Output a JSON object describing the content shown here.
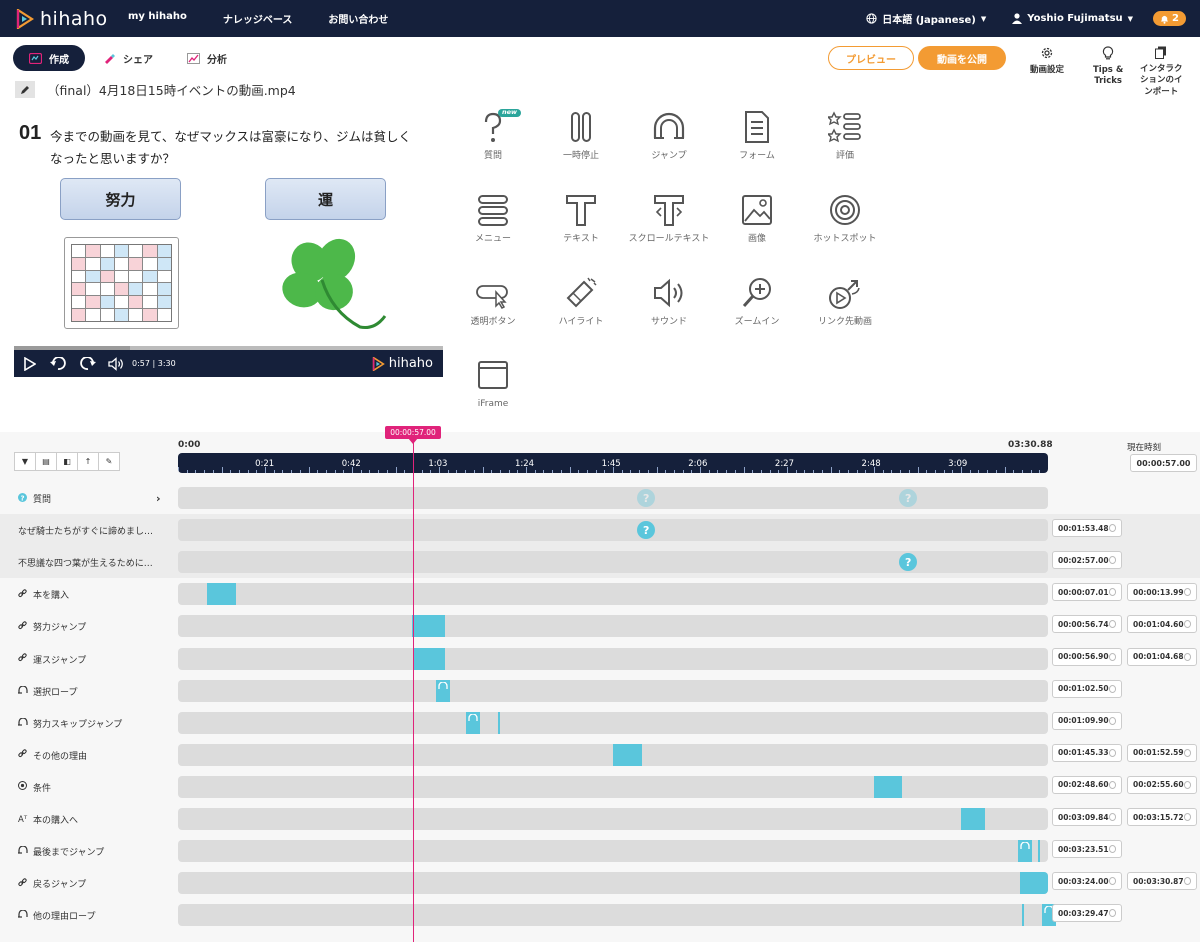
{
  "nav": {
    "brand": "hihaho",
    "links": [
      "my hihaho",
      "ナレッジベース",
      "お問い合わせ"
    ],
    "language": "日本語 (Japanese)",
    "user": "Yoshio Fujimatsu",
    "notifications": "2"
  },
  "tabs": [
    {
      "label": "作成",
      "active": true
    },
    {
      "label": "シェア",
      "active": false
    },
    {
      "label": "分析",
      "active": false
    }
  ],
  "file_title": "（final）4月18日15時イベントの動画.mp4",
  "actions": {
    "preview": "プレビュー",
    "publish": "動画を公開",
    "settings": "動画設定",
    "tips_line1": "Tips &",
    "tips_line2": "Tricks",
    "import_line1": "インタラク",
    "import_line2": "ションのイ",
    "import_line3": "ンポート"
  },
  "video": {
    "question_number": "01",
    "question_line1": "今までの動画を見て、なぜマックスは富豪になり、ジムは貧しく",
    "question_line2": "なったと思いますか？",
    "answer1": "努力",
    "answer2": "運",
    "time": "0:57 | 3:30",
    "brand": "hihaho",
    "progress": 0.27
  },
  "widgets": [
    {
      "label": "質問",
      "icon": "question-icon",
      "badge": "new"
    },
    {
      "label": "一時停止",
      "icon": "pause-icon"
    },
    {
      "label": "ジャンプ",
      "icon": "jump-icon"
    },
    {
      "label": "フォーム",
      "icon": "form-icon"
    },
    {
      "label": "評価",
      "icon": "rating-icon"
    },
    {
      "label": "メニュー",
      "icon": "menu-icon"
    },
    {
      "label": "テキスト",
      "icon": "text-icon"
    },
    {
      "label": "スクロールテキスト",
      "icon": "scroll-text-icon"
    },
    {
      "label": "画像",
      "icon": "image-icon"
    },
    {
      "label": "ホットスポット",
      "icon": "hotspot-icon"
    },
    {
      "label": "透明ボタン",
      "icon": "transparent-button-icon"
    },
    {
      "label": "ハイライト",
      "icon": "highlight-icon"
    },
    {
      "label": "サウンド",
      "icon": "sound-icon"
    },
    {
      "label": "ズームイン",
      "icon": "zoom-in-icon"
    },
    {
      "label": "リンク先動画",
      "icon": "linked-video-icon"
    },
    {
      "label": "iFrame",
      "icon": "iframe-icon"
    }
  ],
  "timeline": {
    "start": "0:00",
    "end": "03:30.88",
    "ticks": [
      "0:21",
      "0:42",
      "1:03",
      "1:24",
      "1:45",
      "2:06",
      "2:27",
      "2:48",
      "3:09"
    ],
    "duration_seconds": 210.88,
    "current_label": "現在時刻",
    "current_time": "00:00:57.00",
    "playhead_label": "00:00:57.00",
    "playhead_seconds": 57,
    "rows": [
      {
        "label": "質問",
        "icon": "question-icon",
        "type": "group",
        "start": null,
        "end": null,
        "markers": [
          113.48,
          177.0
        ]
      },
      {
        "label": "なぜ騎士たちがすぐに諦めまし…",
        "icon": "",
        "type": "question",
        "start": "00:01:53.48",
        "end": null,
        "markers": [
          113.48
        ]
      },
      {
        "label": "不思議な四つ葉が生えるために…",
        "icon": "",
        "type": "question",
        "start": "00:02:57.00",
        "end": null,
        "markers": [
          177.0
        ]
      },
      {
        "label": "本を購入",
        "icon": "link-icon",
        "type": "range",
        "start": "00:00:07.01",
        "end": "00:00:13.99",
        "s": 7.01,
        "e": 13.99
      },
      {
        "label": "努力ジャンプ",
        "icon": "link-icon",
        "type": "range",
        "start": "00:00:56.74",
        "end": "00:01:04.60",
        "s": 56.74,
        "e": 64.6
      },
      {
        "label": "運スジャンプ",
        "icon": "link-icon",
        "type": "range",
        "start": "00:00:56.90",
        "end": "00:01:04.68",
        "s": 56.9,
        "e": 64.68
      },
      {
        "label": "選択ロープ",
        "icon": "jump-icon",
        "type": "jump",
        "start": "00:01:02.50",
        "end": null,
        "s": 62.5
      },
      {
        "label": "努力スキップジャンプ",
        "icon": "jump-icon",
        "type": "jump",
        "start": "00:01:09.90",
        "end": null,
        "s": 69.9,
        "extra": 77.5
      },
      {
        "label": "その他の理由",
        "icon": "link-icon",
        "type": "range",
        "start": "00:01:45.33",
        "end": "00:01:52.59",
        "s": 105.33,
        "e": 112.59
      },
      {
        "label": "条件",
        "icon": "hotspot-icon",
        "type": "range",
        "start": "00:02:48.60",
        "end": "00:02:55.60",
        "s": 168.6,
        "e": 175.6
      },
      {
        "label": "本の購入へ",
        "icon": "text-icon",
        "type": "range",
        "start": "00:03:09.84",
        "end": "00:03:15.72",
        "s": 189.84,
        "e": 195.72
      },
      {
        "label": "最後までジャンプ",
        "icon": "jump-icon",
        "type": "jump",
        "start": "00:03:23.51",
        "end": null,
        "s": 203.51,
        "extra": 208.5
      },
      {
        "label": "戻るジャンプ",
        "icon": "link-icon",
        "type": "range",
        "start": "00:03:24.00",
        "end": "00:03:30.87",
        "s": 204.0,
        "e": 210.87
      },
      {
        "label": "他の理由ロープ",
        "icon": "jump-icon",
        "type": "jump",
        "start": "00:03:29.47",
        "end": null,
        "s": 209.47,
        "extra": 204.5
      }
    ]
  }
}
